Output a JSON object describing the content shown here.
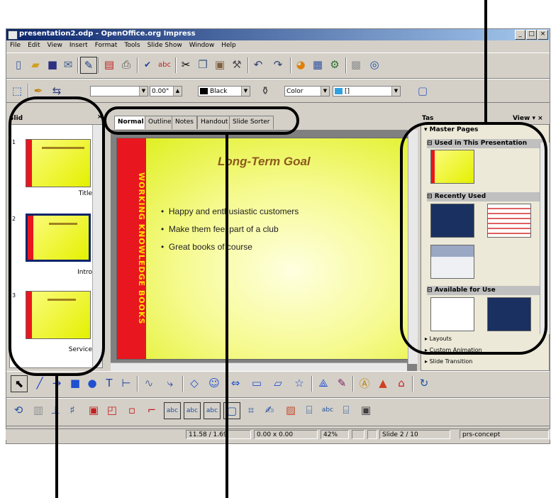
{
  "window": {
    "title": "presentation2.odp - OpenOffice.org Impress",
    "controls": [
      "_",
      "□",
      "×"
    ]
  },
  "menubar": [
    "File",
    "Edit",
    "View",
    "Insert",
    "Format",
    "Tools",
    "Slide Show",
    "Window",
    "Help"
  ],
  "line_toolbar": {
    "line_width": "0.00\"",
    "line_color": "Black",
    "area_style": "Color",
    "area_color": "[]"
  },
  "slides_pane": {
    "title": "Slid",
    "close": "×",
    "slides": [
      {
        "number": "1",
        "label": "Title"
      },
      {
        "number": "2",
        "label": "Intro"
      },
      {
        "number": "3",
        "label": "Service"
      }
    ]
  },
  "view_tabs": [
    "Normal",
    "Outline",
    "Notes",
    "Handout",
    "Slide Sorter"
  ],
  "slide": {
    "side_text": "WORKING KNOWLEDGE BOOKS",
    "title": "Long-Term Goal",
    "bullets": [
      "Happy and enthusiastic customers",
      "Make them feel part of a club",
      "Great books of course"
    ]
  },
  "task_pane": {
    "title": "Tas",
    "view": "View",
    "master_pages": "Master Pages",
    "sections": [
      "Used in This Presentation",
      "Recently Used",
      "Available for Use"
    ],
    "collapsed": [
      "Layouts",
      "Custom Animation",
      "Slide Transition"
    ]
  },
  "statusbar": {
    "position": "11.58 / 1.69",
    "size": "0.00 x 0.00",
    "zoom": "42%",
    "slide": "Slide 2 / 10",
    "master": "prs-concept"
  },
  "colors": {
    "title_bar": "#0a246a",
    "slide_red": "#e8161e",
    "slide_yellow": "#e4f000",
    "title_text": "#8c5a1e"
  }
}
